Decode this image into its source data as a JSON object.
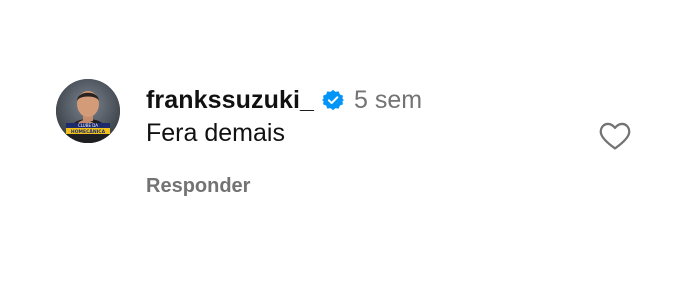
{
  "comment": {
    "username": "frankssuzuki_",
    "verified": true,
    "timestamp": "5 sem",
    "text": "Fera demais",
    "reply_label": "Responder",
    "avatar": {
      "badge_line1": "CLUBE DA",
      "badge_line2": "HOMECÂNICA"
    }
  },
  "icons": {
    "verified": "verified-check-icon",
    "like": "heart-outline-icon"
  },
  "colors": {
    "verified_blue": "#0095f6",
    "text_primary": "#111111",
    "text_secondary": "#737373",
    "heart_stroke": "#737373"
  }
}
